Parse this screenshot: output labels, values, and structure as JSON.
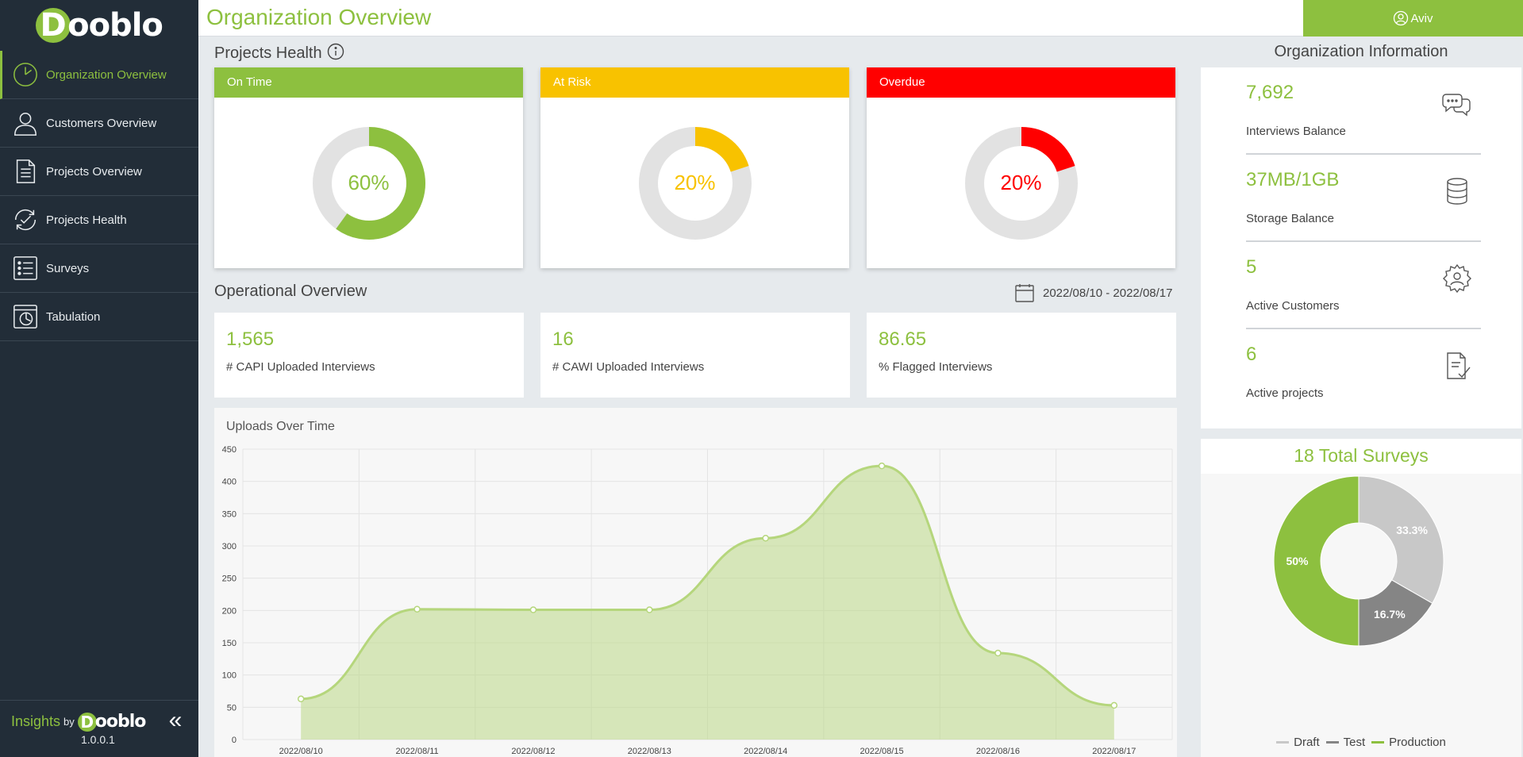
{
  "header": {
    "title": "Organization Overview",
    "user": "Aviv"
  },
  "brand": {
    "letter": "D",
    "rest": "ooblo"
  },
  "sidebar": {
    "items": [
      {
        "label": "Organization Overview",
        "icon": "chart-pie-icon",
        "active": true
      },
      {
        "label": "Customers Overview",
        "icon": "user-icon",
        "active": false
      },
      {
        "label": "Projects Overview",
        "icon": "document-icon",
        "active": false
      },
      {
        "label": "Projects Health",
        "icon": "refresh-check-icon",
        "active": false
      },
      {
        "label": "Surveys",
        "icon": "list-icon",
        "active": false
      },
      {
        "label": "Tabulation",
        "icon": "table-chart-icon",
        "active": false
      }
    ],
    "footer": {
      "insights": "Insights",
      "by": "by",
      "version": "1.0.0.1",
      "collapse": "«"
    }
  },
  "health": {
    "title": "Projects Health",
    "cards": [
      {
        "label": "On Time",
        "percent": "60%",
        "value": 60,
        "color": "#8dc03f"
      },
      {
        "label": "At Risk",
        "percent": "20%",
        "value": 20,
        "color": "#f8c200"
      },
      {
        "label": "Overdue",
        "percent": "20%",
        "value": 20,
        "color": "#ff0000"
      }
    ]
  },
  "operational": {
    "title": "Operational Overview",
    "date_range": "2022/08/10 - 2022/08/17",
    "kpis": [
      {
        "value": "1,565",
        "label": "# CAPI Uploaded Interviews"
      },
      {
        "value": "16",
        "label": "# CAWI Uploaded Interviews"
      },
      {
        "value": "86.65",
        "label": "% Flagged Interviews"
      }
    ]
  },
  "org": {
    "title": "Organization Information",
    "rows": [
      {
        "value": "7,692",
        "label": "Interviews Balance",
        "icon": "chat-icon"
      },
      {
        "value": "37MB/1GB",
        "label": "Storage Balance",
        "icon": "database-icon"
      },
      {
        "value": "5",
        "label": "Active Customers",
        "icon": "gear-user-icon"
      },
      {
        "value": "6",
        "label": "Active projects",
        "icon": "document-check-icon"
      }
    ]
  },
  "surveys": {
    "title": "18 Total Surveys"
  },
  "colors": {
    "accent": "#8dc03f",
    "sidebar": "#222d38"
  },
  "chart_data": [
    {
      "type": "area",
      "title": "Uploads Over Time",
      "x": [
        "2022/08/10",
        "2022/08/11",
        "2022/08/12",
        "2022/08/13",
        "2022/08/14",
        "2022/08/15",
        "2022/08/16",
        "2022/08/17"
      ],
      "series": [
        {
          "values": [
            63,
            202,
            201,
            201,
            312,
            424,
            134,
            53
          ]
        }
      ],
      "ylim": [
        0,
        450
      ],
      "yticks": [
        0,
        50,
        100,
        150,
        200,
        250,
        300,
        350,
        400,
        450
      ],
      "grid": true,
      "color": "#b5d67c"
    },
    {
      "type": "pie",
      "categories": [
        "Draft",
        "Test",
        "Production"
      ],
      "values": [
        33.3,
        16.7,
        50
      ],
      "labels": [
        "33.3%",
        "16.7%",
        "50%"
      ],
      "colors": [
        "#c8c8c8",
        "#858585",
        "#8dc03f"
      ],
      "legend": "bottom"
    }
  ]
}
